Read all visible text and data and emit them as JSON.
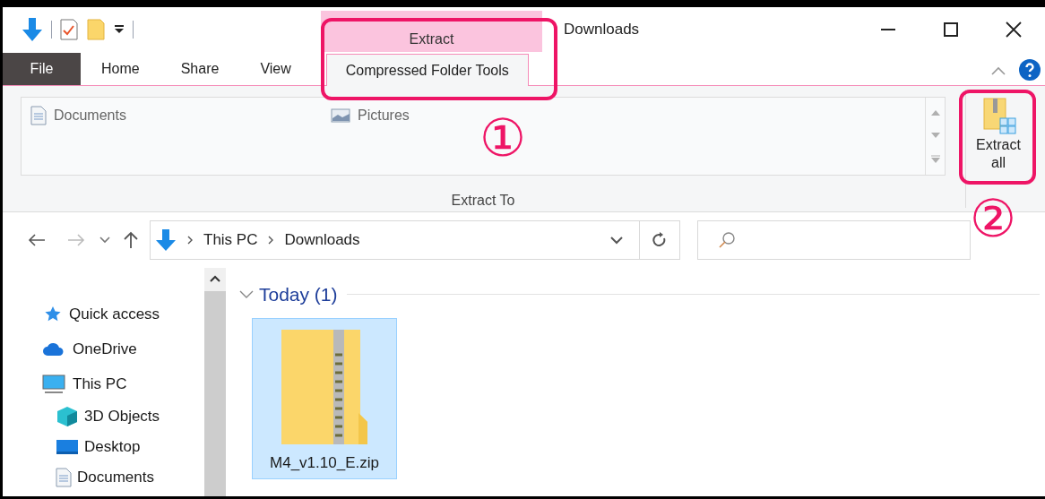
{
  "window": {
    "title": "Downloads"
  },
  "tab_group": {
    "label": "Extract"
  },
  "ribbon_tabs": [
    {
      "label": "File",
      "kind": "file",
      "selected": false
    },
    {
      "label": "Home",
      "kind": "tab",
      "selected": false
    },
    {
      "label": "Share",
      "kind": "tab",
      "selected": false
    },
    {
      "label": "View",
      "kind": "tab",
      "selected": false
    },
    {
      "label": "Compressed Folder Tools",
      "kind": "tab",
      "selected": true
    }
  ],
  "ribbon": {
    "destinations": [
      {
        "label": "Documents",
        "kind": "documents"
      },
      {
        "label": "Pictures",
        "kind": "pictures"
      }
    ],
    "group_label": "Extract To",
    "extract_all": "Extract all"
  },
  "address_bar": {
    "path": [
      "This PC",
      "Downloads"
    ]
  },
  "navigation_pane": [
    {
      "label": "Quick access",
      "kind": "star"
    },
    {
      "label": "OneDrive",
      "kind": "cloud"
    },
    {
      "label": "This PC",
      "kind": "pc",
      "children": [
        {
          "label": "3D Objects",
          "kind": "cube"
        },
        {
          "label": "Desktop",
          "kind": "desktop"
        },
        {
          "label": "Documents",
          "kind": "documents"
        }
      ]
    }
  ],
  "content": {
    "group": {
      "label": "Today (1)",
      "expanded": true
    },
    "files": [
      {
        "name": "M4_v1.10_E.zip",
        "selected": true
      }
    ]
  },
  "annotations": [
    {
      "label": "①"
    },
    {
      "label": "②"
    }
  ]
}
